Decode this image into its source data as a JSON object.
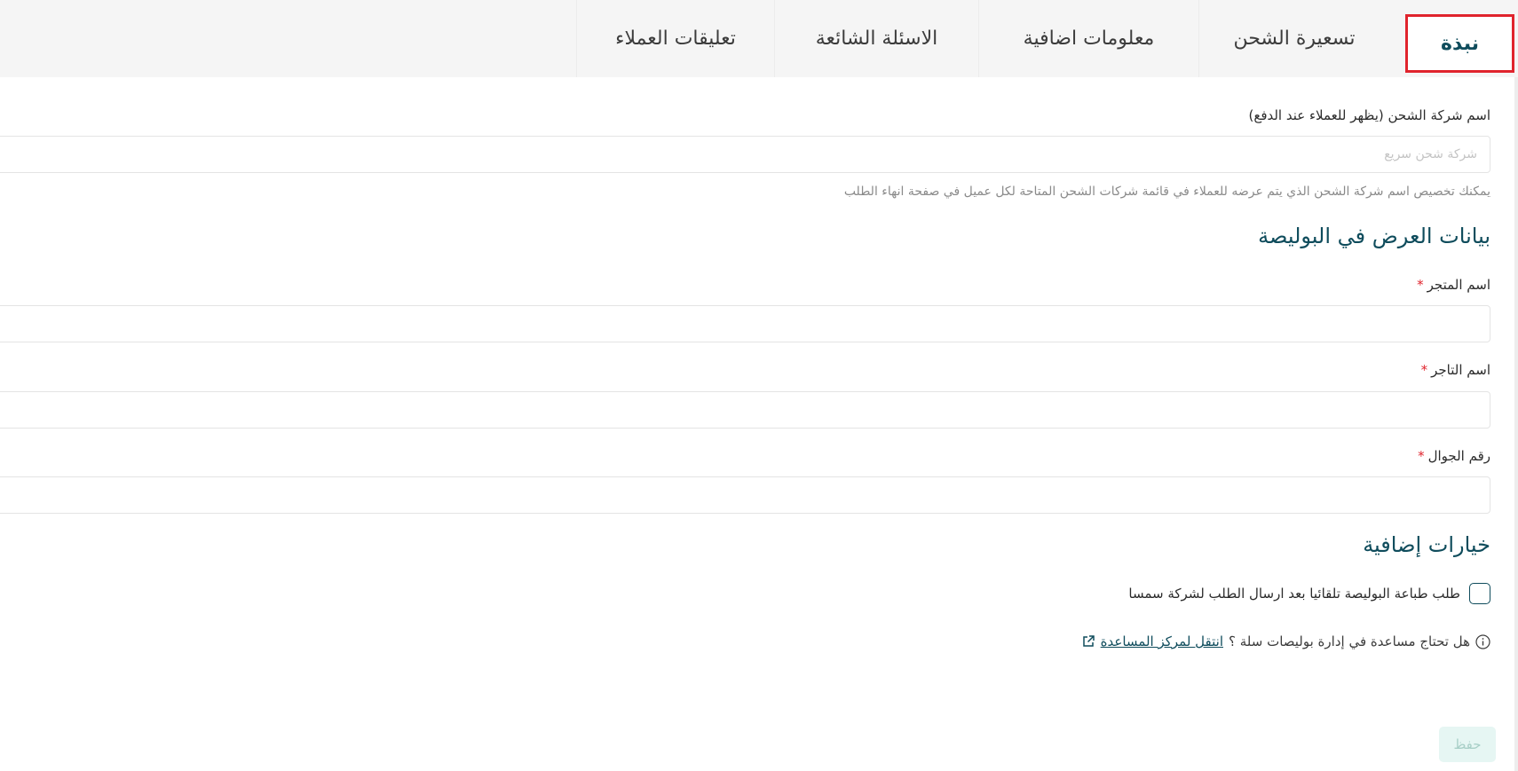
{
  "tabs": {
    "overview": "نبذة",
    "shipping_pricing": "تسعيرة الشحن",
    "additional_info": "معلومات اضافية",
    "faq": "الاسئلة الشائعة",
    "customer_reviews": "تعليقات العملاء"
  },
  "form": {
    "company_name_label": "اسم شركة الشحن (يظهر للعملاء عند الدفع)",
    "company_name_placeholder": "شركة شحن سريع",
    "company_name_hint": "يمكنك تخصيص اسم شركة الشحن الذي يتم عرضه للعملاء في قائمة شركات الشحن المتاحة لكل عميل في صفحة انهاء الطلب",
    "waybill_section_title": "بيانات العرض في البوليصة",
    "store_name_label": "اسم المتجر",
    "merchant_name_label": "اسم التاجر",
    "mobile_label": "رقم الجوال",
    "required_mark": "*",
    "extra_options_title": "خيارات إضافية",
    "auto_print_label": "طلب طباعة البوليصة تلقائيا بعد ارسال الطلب لشركة سمسا",
    "help_text": "هل تحتاج مساعدة في إدارة بوليصات سلة ؟",
    "help_link": "انتقل لمركز المساعدة",
    "save_label": "حفظ"
  },
  "colors": {
    "accent": "#0f4c5c",
    "active_tab_border": "#e0242d",
    "save_button_bg": "#e6f6f3"
  }
}
